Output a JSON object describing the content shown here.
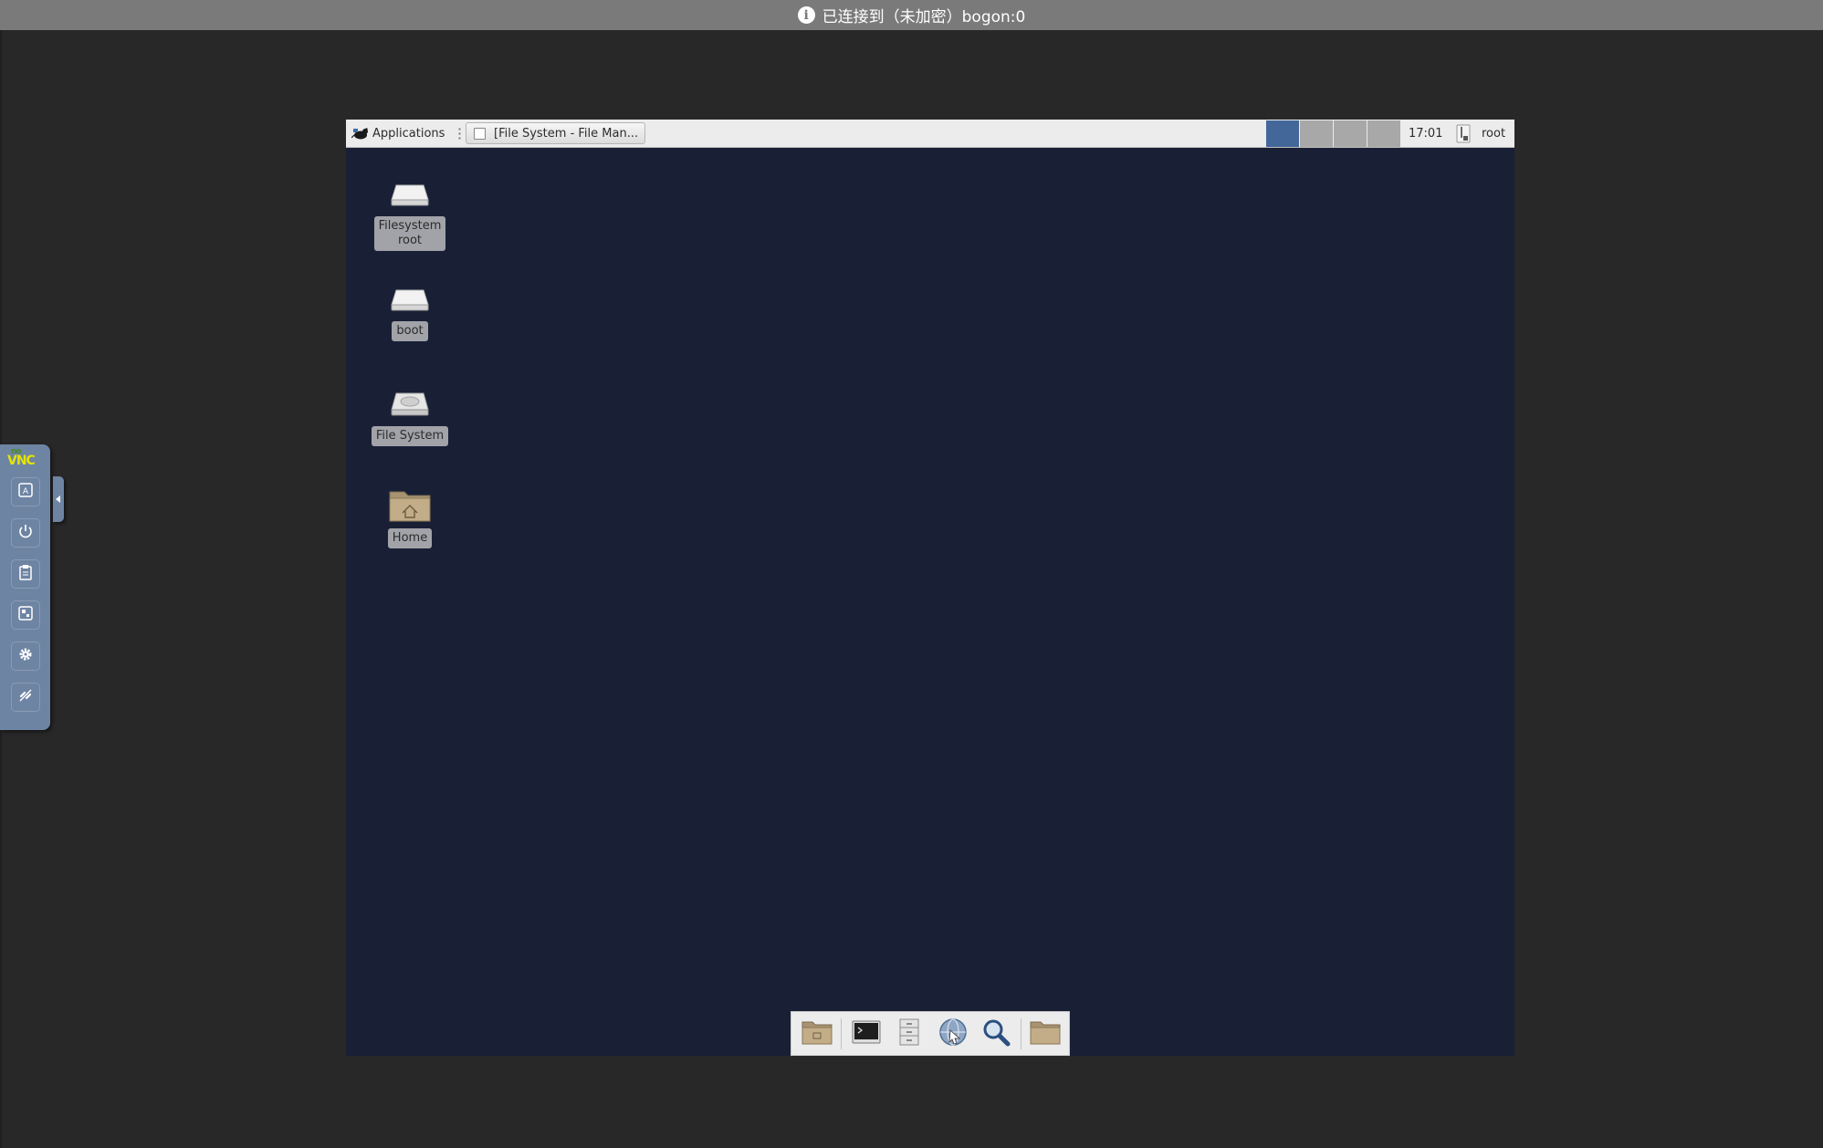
{
  "status_bar": {
    "icon": "info-icon",
    "text": "已连接到（未加密）bogon:0"
  },
  "vnc_panel": {
    "logo_small": "no",
    "logo_main": "VNC",
    "buttons": [
      {
        "name": "extra-keys",
        "icon": "keyboard-a-icon"
      },
      {
        "name": "power",
        "icon": "power-icon"
      },
      {
        "name": "clipboard",
        "icon": "clipboard-icon"
      },
      {
        "name": "fullscreen",
        "icon": "fullscreen-icon"
      },
      {
        "name": "settings",
        "icon": "gear-icon"
      },
      {
        "name": "disconnect",
        "icon": "disconnect-icon"
      }
    ]
  },
  "panel": {
    "applications_label": "Applications",
    "task_label": "[File System - File Man...",
    "workspaces": 4,
    "active_workspace": 1,
    "clock": "17:01",
    "user": "root"
  },
  "desktop_icons": [
    {
      "label_line1": "Filesystem",
      "label_line2": "root",
      "icon": "drive-icon"
    },
    {
      "label_line1": "boot",
      "label_line2": "",
      "icon": "drive-icon"
    },
    {
      "label_line1": "File System",
      "label_line2": "",
      "icon": "harddisk-icon"
    },
    {
      "label_line1": "Home",
      "label_line2": "",
      "icon": "home-folder-icon"
    }
  ],
  "dock": {
    "items": [
      "show-desktop-icon",
      "terminal-icon",
      "file-manager-icon",
      "web-browser-icon",
      "search-icon",
      "folder-icon"
    ]
  },
  "colors": {
    "desktop_bg": "#192036",
    "active_workspace": "#44679a",
    "vnc_panel": "#6e84a3"
  }
}
